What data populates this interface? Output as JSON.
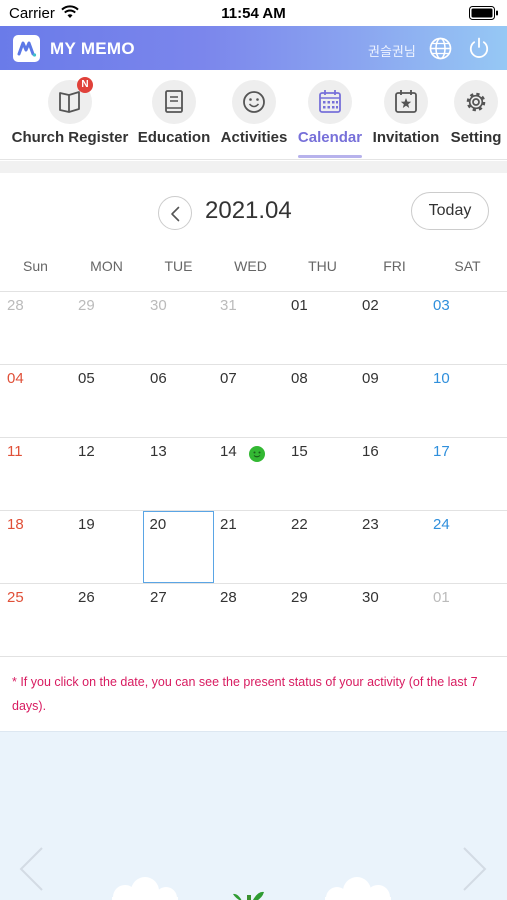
{
  "status_bar": {
    "carrier": "Carrier",
    "time": "11:54 AM"
  },
  "header": {
    "app_title": "MY MEMO",
    "user_name": "권슬권님"
  },
  "tabs": [
    {
      "label": "Church Register",
      "icon": "book-open-icon",
      "badge": "N",
      "active": false
    },
    {
      "label": "Education",
      "icon": "book-icon",
      "active": false
    },
    {
      "label": "Activities",
      "icon": "smiley-icon",
      "active": false
    },
    {
      "label": "Calendar",
      "icon": "calendar-icon",
      "active": true
    },
    {
      "label": "Invitation",
      "icon": "calendar-star-icon",
      "active": false
    },
    {
      "label": "Setting",
      "icon": "gear-icon",
      "active": false
    }
  ],
  "calendar": {
    "month_title": "2021.04",
    "today_label": "Today",
    "weekdays": [
      "Sun",
      "MON",
      "TUE",
      "WED",
      "THU",
      "FRI",
      "SAT"
    ],
    "weeks": [
      [
        "28",
        "29",
        "30",
        "31",
        "01",
        "02",
        "03"
      ],
      [
        "04",
        "05",
        "06",
        "07",
        "08",
        "09",
        "10"
      ],
      [
        "11",
        "12",
        "13",
        "14",
        "15",
        "16",
        "17"
      ],
      [
        "18",
        "19",
        "20",
        "21",
        "22",
        "23",
        "24"
      ],
      [
        "25",
        "26",
        "27",
        "28",
        "29",
        "30",
        "01"
      ]
    ],
    "selected_date": "20",
    "mood_marker_date": "14"
  },
  "note": "* If you click on the date, you can see the present status of your activity (of the last 7 days).",
  "colors": {
    "header_gradient_start": "#6a7be9",
    "header_gradient_end": "#96c8f4",
    "active_tab": "#7770d9",
    "sunday": "#e05038",
    "saturday": "#2f8fdc",
    "note": "#d81b60",
    "mood_marker": "#33b833"
  }
}
